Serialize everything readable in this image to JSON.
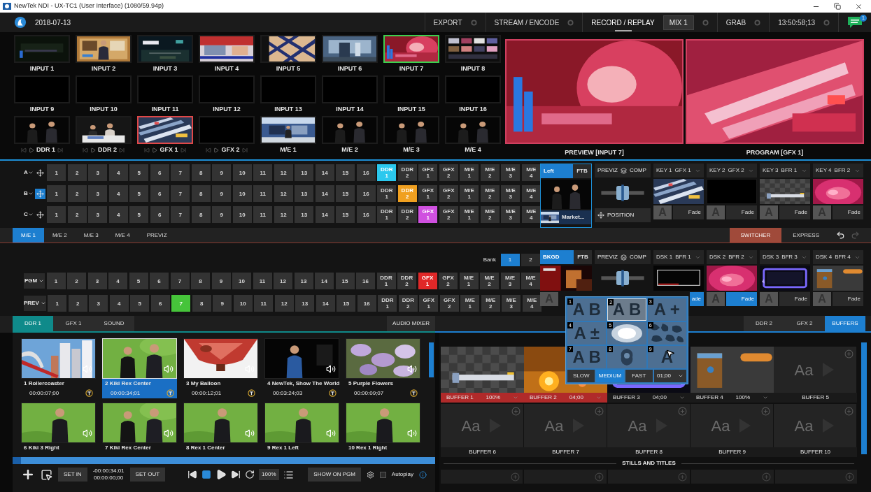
{
  "window": {
    "title": "NewTek NDI - UX-TC1 (User Interface) (1080/59.94p)"
  },
  "header": {
    "date": "2018-07-13",
    "notifications": "1",
    "items": [
      {
        "label": "EXPORT",
        "selected": false
      },
      {
        "label": "STREAM / ENCODE",
        "selected": false
      },
      {
        "label": "RECORD / REPLAY",
        "selected": true,
        "tag": "MIX 1"
      },
      {
        "label": "GRAB",
        "selected": false
      },
      {
        "label": "13:50:58;13",
        "selected": false
      }
    ]
  },
  "inputs": [
    {
      "label": "INPUT 1",
      "kind": "picture",
      "transport": false,
      "on_preview": false,
      "on_program": false
    },
    {
      "label": "INPUT 2",
      "kind": "picture",
      "transport": false,
      "on_preview": false,
      "on_program": false
    },
    {
      "label": "INPUT 3",
      "kind": "picture",
      "transport": false,
      "on_preview": false,
      "on_program": false
    },
    {
      "label": "INPUT 4",
      "kind": "picture",
      "transport": false,
      "on_preview": false,
      "on_program": false
    },
    {
      "label": "INPUT 5",
      "kind": "picture",
      "transport": false,
      "on_preview": false,
      "on_program": false
    },
    {
      "label": "INPUT 6",
      "kind": "picture",
      "transport": false,
      "on_preview": false,
      "on_program": false
    },
    {
      "label": "INPUT 7",
      "kind": "picture",
      "transport": false,
      "on_preview": true,
      "on_program": false
    },
    {
      "label": "INPUT 8",
      "kind": "picture",
      "transport": false,
      "on_preview": false,
      "on_program": false
    },
    {
      "label": "INPUT 9",
      "kind": "empty",
      "transport": false,
      "on_preview": false,
      "on_program": false
    },
    {
      "label": "INPUT 10",
      "kind": "empty",
      "transport": false,
      "on_preview": false,
      "on_program": false
    },
    {
      "label": "INPUT 11",
      "kind": "empty",
      "transport": false,
      "on_preview": false,
      "on_program": false
    },
    {
      "label": "INPUT 12",
      "kind": "empty",
      "transport": false,
      "on_preview": false,
      "on_program": false
    },
    {
      "label": "INPUT 13",
      "kind": "empty",
      "transport": false,
      "on_preview": false,
      "on_program": false
    },
    {
      "label": "INPUT 14",
      "kind": "empty",
      "transport": false,
      "on_preview": false,
      "on_program": false
    },
    {
      "label": "INPUT 15",
      "kind": "empty",
      "transport": false,
      "on_preview": false,
      "on_program": false
    },
    {
      "label": "INPUT 16",
      "kind": "empty",
      "transport": false,
      "on_preview": false,
      "on_program": false
    },
    {
      "label": "DDR 1",
      "kind": "picture",
      "transport": true,
      "on_preview": false,
      "on_program": false
    },
    {
      "label": "DDR 2",
      "kind": "picture",
      "transport": true,
      "on_preview": false,
      "on_program": false
    },
    {
      "label": "GFX 1",
      "kind": "picture",
      "transport": true,
      "on_preview": false,
      "on_program": true
    },
    {
      "label": "GFX 2",
      "kind": "empty",
      "transport": true,
      "on_preview": false,
      "on_program": false
    },
    {
      "label": "M/E 1",
      "kind": "picture",
      "transport": false,
      "on_preview": false,
      "on_program": false
    },
    {
      "label": "M/E 2",
      "kind": "picture",
      "transport": false,
      "on_preview": false,
      "on_program": false
    },
    {
      "label": "M/E 3",
      "kind": "picture",
      "transport": false,
      "on_preview": false,
      "on_program": false
    },
    {
      "label": "M/E 4",
      "kind": "picture",
      "transport": false,
      "on_preview": false,
      "on_program": false
    }
  ],
  "monitors": [
    {
      "label": "PREVIEW [INPUT 7]"
    },
    {
      "label": "PROGRAM [GFX 1]"
    }
  ],
  "key_rows": [
    {
      "label": "A",
      "color": "#2bc8ee",
      "position_active": false,
      "buttons": [
        {
          "label": "1",
          "selected": false
        },
        {
          "label": "2",
          "selected": false
        },
        {
          "label": "3",
          "selected": false
        },
        {
          "label": "4",
          "selected": false
        },
        {
          "label": "5",
          "selected": false
        },
        {
          "label": "6",
          "selected": false
        },
        {
          "label": "7",
          "selected": false
        },
        {
          "label": "8",
          "selected": false
        },
        {
          "label": "9",
          "selected": false
        },
        {
          "label": "10",
          "selected": false
        },
        {
          "label": "11",
          "selected": false
        },
        {
          "label": "12",
          "selected": false
        },
        {
          "label": "13",
          "selected": false
        },
        {
          "label": "14",
          "selected": false
        },
        {
          "label": "15",
          "selected": false
        },
        {
          "label": "16",
          "selected": false
        },
        {
          "label": "DDR 1",
          "selected": true
        },
        {
          "label": "DDR 2",
          "selected": false
        },
        {
          "label": "GFX 1",
          "selected": false
        },
        {
          "label": "GFX 2",
          "selected": false
        },
        {
          "label": "M/E 1",
          "selected": false
        },
        {
          "label": "M/E 2",
          "selected": false
        },
        {
          "label": "M/E 3",
          "selected": false
        },
        {
          "label": "M/E 4",
          "selected": false
        }
      ]
    },
    {
      "label": "B",
      "color": "#f0a020",
      "position_active": true,
      "buttons": [
        {
          "label": "1",
          "selected": false
        },
        {
          "label": "2",
          "selected": false
        },
        {
          "label": "3",
          "selected": false
        },
        {
          "label": "4",
          "selected": false
        },
        {
          "label": "5",
          "selected": false
        },
        {
          "label": "6",
          "selected": false
        },
        {
          "label": "7",
          "selected": false
        },
        {
          "label": "8",
          "selected": false
        },
        {
          "label": "9",
          "selected": false
        },
        {
          "label": "10",
          "selected": false
        },
        {
          "label": "11",
          "selected": false
        },
        {
          "label": "12",
          "selected": false
        },
        {
          "label": "13",
          "selected": false
        },
        {
          "label": "14",
          "selected": false
        },
        {
          "label": "15",
          "selected": false
        },
        {
          "label": "16",
          "selected": false
        },
        {
          "label": "DDR 1",
          "selected": false
        },
        {
          "label": "DDR 2",
          "selected": true
        },
        {
          "label": "GFX 1",
          "selected": false
        },
        {
          "label": "GFX 2",
          "selected": false
        },
        {
          "label": "M/E 1",
          "selected": false
        },
        {
          "label": "M/E 2",
          "selected": false
        },
        {
          "label": "M/E 3",
          "selected": false
        },
        {
          "label": "M/E 4",
          "selected": false
        }
      ]
    },
    {
      "label": "C",
      "color": "#d050e0",
      "position_active": false,
      "buttons": [
        {
          "label": "1",
          "selected": false
        },
        {
          "label": "2",
          "selected": false
        },
        {
          "label": "3",
          "selected": false
        },
        {
          "label": "4",
          "selected": false
        },
        {
          "label": "5",
          "selected": false
        },
        {
          "label": "6",
          "selected": false
        },
        {
          "label": "7",
          "selected": false
        },
        {
          "label": "8",
          "selected": false
        },
        {
          "label": "9",
          "selected": false
        },
        {
          "label": "10",
          "selected": false
        },
        {
          "label": "11",
          "selected": false
        },
        {
          "label": "12",
          "selected": false
        },
        {
          "label": "13",
          "selected": false
        },
        {
          "label": "14",
          "selected": false
        },
        {
          "label": "15",
          "selected": false
        },
        {
          "label": "16",
          "selected": false
        },
        {
          "label": "DDR 1",
          "selected": false
        },
        {
          "label": "DDR 2",
          "selected": false
        },
        {
          "label": "GFX 1",
          "selected": true
        },
        {
          "label": "GFX 2",
          "selected": false
        },
        {
          "label": "M/E 1",
          "selected": false
        },
        {
          "label": "M/E 2",
          "selected": false
        },
        {
          "label": "M/E 3",
          "selected": false
        },
        {
          "label": "M/E 4",
          "selected": false
        }
      ]
    }
  ],
  "transition": {
    "buttons": [
      {
        "label": "Left",
        "selected": true
      },
      {
        "label": "FTB",
        "selected": false
      }
    ],
    "source": "Market..."
  },
  "previz": {
    "label": "PREVIZ",
    "comp": "COMP",
    "position": "POSITION"
  },
  "keys": [
    {
      "name": "KEY 1",
      "source": "GFX 1",
      "icon": "A",
      "transition": "Fade",
      "selected": false
    },
    {
      "name": "KEY 2",
      "source": "GFX 2",
      "icon": "A",
      "transition": "Fade",
      "selected": false
    },
    {
      "name": "KEY 3",
      "source": "BFR 1",
      "icon": "A",
      "transition": "Fade",
      "selected": false
    },
    {
      "name": "KEY 4",
      "source": "BFR 2",
      "icon": "A",
      "transition": "Fade",
      "selected": false
    }
  ],
  "me_tabs": [
    {
      "label": "M/E 1",
      "selected": true
    },
    {
      "label": "M/E 2",
      "selected": false
    },
    {
      "label": "M/E 3",
      "selected": false
    },
    {
      "label": "M/E 4",
      "selected": false
    },
    {
      "label": "PREVIZ",
      "selected": false
    }
  ],
  "mode_tabs": [
    {
      "label": "SWITCHER",
      "selected": true
    },
    {
      "label": "EXPRESS",
      "selected": false
    }
  ],
  "bank": {
    "label": "Bank",
    "buttons": [
      {
        "label": "1",
        "selected": true
      },
      {
        "label": "2",
        "selected": false
      }
    ]
  },
  "bus_rows": [
    {
      "label": "PGM",
      "color": "#e02828",
      "buttons": [
        {
          "label": "1",
          "selected": false
        },
        {
          "label": "2",
          "selected": false
        },
        {
          "label": "3",
          "selected": false
        },
        {
          "label": "4",
          "selected": false
        },
        {
          "label": "5",
          "selected": false
        },
        {
          "label": "6",
          "selected": false
        },
        {
          "label": "7",
          "selected": false
        },
        {
          "label": "8",
          "selected": false
        },
        {
          "label": "9",
          "selected": false
        },
        {
          "label": "10",
          "selected": false
        },
        {
          "label": "11",
          "selected": false
        },
        {
          "label": "12",
          "selected": false
        },
        {
          "label": "13",
          "selected": false
        },
        {
          "label": "14",
          "selected": false
        },
        {
          "label": "15",
          "selected": false
        },
        {
          "label": "16",
          "selected": false
        },
        {
          "label": "DDR 1",
          "selected": false
        },
        {
          "label": "DDR 2",
          "selected": false
        },
        {
          "label": "GFX 1",
          "selected": true
        },
        {
          "label": "GFX 2",
          "selected": false
        },
        {
          "label": "M/E 1",
          "selected": false
        },
        {
          "label": "M/E 2",
          "selected": false
        },
        {
          "label": "M/E 3",
          "selected": false
        },
        {
          "label": "M/E 4",
          "selected": false
        }
      ]
    },
    {
      "label": "PREV",
      "color": "#46c43a",
      "buttons": [
        {
          "label": "1",
          "selected": false
        },
        {
          "label": "2",
          "selected": false
        },
        {
          "label": "3",
          "selected": false
        },
        {
          "label": "4",
          "selected": false
        },
        {
          "label": "5",
          "selected": false
        },
        {
          "label": "6",
          "selected": false
        },
        {
          "label": "7",
          "selected": true
        },
        {
          "label": "8",
          "selected": false
        },
        {
          "label": "9",
          "selected": false
        },
        {
          "label": "10",
          "selected": false
        },
        {
          "label": "11",
          "selected": false
        },
        {
          "label": "12",
          "selected": false
        },
        {
          "label": "13",
          "selected": false
        },
        {
          "label": "14",
          "selected": false
        },
        {
          "label": "15",
          "selected": false
        },
        {
          "label": "16",
          "selected": false
        },
        {
          "label": "DDR 1",
          "selected": false
        },
        {
          "label": "DDR 2",
          "selected": false
        },
        {
          "label": "GFX 1",
          "selected": false
        },
        {
          "label": "GFX 2",
          "selected": false
        },
        {
          "label": "M/E 1",
          "selected": false
        },
        {
          "label": "M/E 2",
          "selected": false
        },
        {
          "label": "M/E 3",
          "selected": false
        },
        {
          "label": "M/E 4",
          "selected": false
        }
      ]
    }
  ],
  "background": {
    "buttons": [
      {
        "label": "BKGD",
        "selected": true
      },
      {
        "label": "FTB",
        "selected": false
      }
    ],
    "icon": "A"
  },
  "previz_main": {
    "label": "PREVIZ",
    "comp": "COMP"
  },
  "dsks": [
    {
      "name": "DSK 1",
      "source": "BFR 1",
      "transition": "ade",
      "selected": true
    },
    {
      "name": "DSK 2",
      "source": "BFR 2",
      "icon": "A",
      "transition": "Fade",
      "selected": true
    },
    {
      "name": "DSK 3",
      "source": "BFR 3",
      "icon": "A",
      "transition": "Fade",
      "selected": false
    },
    {
      "name": "DSK 4",
      "source": "BFR 4",
      "icon": "A",
      "transition": "Fade",
      "selected": false
    }
  ],
  "transition_picker": {
    "duration": "01;00",
    "cells": [
      {
        "number": "1",
        "kind": "glyph",
        "glyph": "A B",
        "selected": false
      },
      {
        "number": "2",
        "kind": "glyph",
        "glyph": "A B",
        "selected": true
      },
      {
        "number": "3",
        "kind": "glyph",
        "glyph": "A +",
        "selected": false
      },
      {
        "number": "4",
        "kind": "glyph",
        "glyph": "A ±",
        "selected": false
      },
      {
        "number": "5",
        "kind": "glow",
        "selected": false
      },
      {
        "number": "6",
        "kind": "camo",
        "selected": false
      },
      {
        "number": "7",
        "kind": "glyph",
        "glyph": "A B",
        "selected": false
      },
      {
        "number": "8",
        "kind": "blob",
        "selected": false
      },
      {
        "number": "9",
        "kind": "glyph",
        "glyph": "A",
        "selected": false
      }
    ],
    "speeds": [
      {
        "label": "SLOW",
        "selected": false
      },
      {
        "label": "MEDIUM",
        "selected": true
      },
      {
        "label": "FAST",
        "selected": false
      }
    ]
  },
  "media_tabs": [
    {
      "label": "DDR 1",
      "selected": true
    },
    {
      "label": "GFX 1",
      "selected": false
    },
    {
      "label": "SOUND",
      "selected": false
    }
  ],
  "audio_mixer": "AUDIO MIXER",
  "buffer_tabs": [
    {
      "label": "DDR 2",
      "selected": false
    },
    {
      "label": "GFX 2",
      "selected": false
    },
    {
      "label": "BUFFERS",
      "selected": true
    }
  ],
  "clips": [
    {
      "title": "1 Rollercoaster",
      "duration": "00:00:07;00",
      "selected": false
    },
    {
      "title": "2 Kiki Rex Center",
      "duration": "00:00:34;01",
      "selected": true
    },
    {
      "title": "3 My Balloon",
      "duration": "00:00:12;01",
      "selected": false
    },
    {
      "title": "4 NewTek, Show The World",
      "duration": "00:03:24;03",
      "selected": false
    },
    {
      "title": "5 Purple Flowers",
      "duration": "00:00:09;07",
      "selected": false
    },
    {
      "title": "6 Kiki 3 Right",
      "selected": false
    },
    {
      "title": "7 Kiki Rex Center",
      "selected": false
    },
    {
      "title": "8 Rex 1 Center",
      "selected": false
    },
    {
      "title": "9 Rex 1 Left",
      "selected": false
    },
    {
      "title": "10 Rex 1 Right",
      "selected": false
    }
  ],
  "ddr_controls": {
    "set_in": "SET IN",
    "time_in": "-00:00:34;01",
    "time_out": "00:00:00;00",
    "set_out": "SET OUT",
    "speed": "100%",
    "show": "SHOW ON PGM",
    "autoplay": {
      "label": "Autoplay",
      "checked": false
    }
  },
  "buffers": [
    {
      "label": "BUFFER 1",
      "value": "100%",
      "active": true,
      "kind": "picture"
    },
    {
      "label": "BUFFER 2",
      "value": "04;00",
      "active": true,
      "kind": "picture"
    },
    {
      "label": "BUFFER 3",
      "value": "04;00",
      "active": false,
      "kind": "picture"
    },
    {
      "label": "BUFFER 4",
      "value": "100%",
      "active": false,
      "kind": "picture"
    },
    {
      "label": "BUFFER 5",
      "active": false,
      "kind": "empty",
      "placeholder": "Aa"
    },
    {
      "label": "BUFFER 6",
      "active": false,
      "kind": "empty",
      "placeholder": "Aa"
    },
    {
      "label": "BUFFER 7",
      "active": false,
      "kind": "empty",
      "placeholder": "Aa"
    },
    {
      "label": "BUFFER 8",
      "active": false,
      "kind": "empty",
      "placeholder": "Aa"
    },
    {
      "label": "BUFFER 9",
      "active": false,
      "kind": "empty",
      "placeholder": "Aa"
    },
    {
      "label": "BUFFER 10",
      "active": false,
      "kind": "empty",
      "placeholder": "Aa"
    }
  ],
  "stills_heading": "STILLS AND TITLES"
}
